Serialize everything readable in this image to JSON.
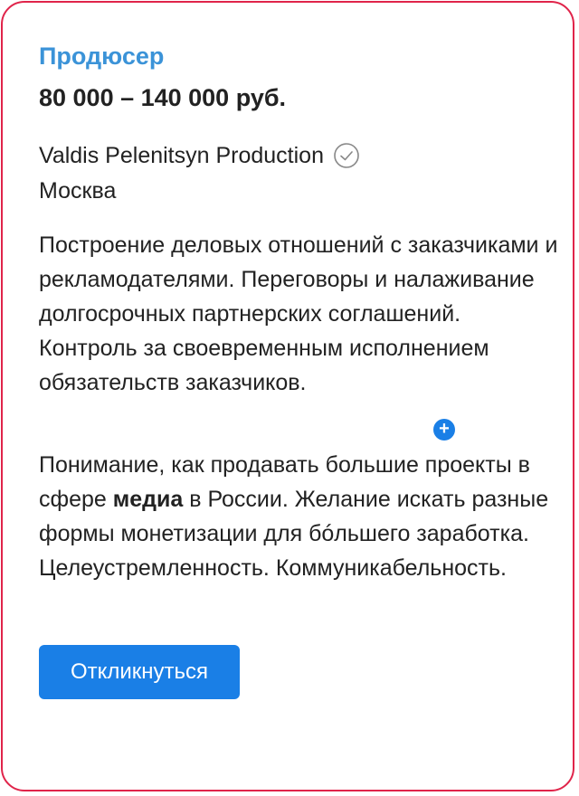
{
  "vacancy": {
    "title": "Продюсер",
    "salary": "80 000 – 140 000 руб.",
    "company": "Valdis Pelenitsyn Production",
    "company_verified_icon": "verified-check-icon",
    "city": "Москва",
    "responsibilities": "Построение деловых отношений с заказчиками и рекламодателями. Переговоры и налаживание долгосрочных партнерских соглашений. Контроль за своевременным исполнением обязательств заказчиков.",
    "requirements": {
      "before_highlight": "Понимание, как продавать большие проекты в сфере ",
      "highlight": "медиа",
      "after_highlight": " в России. Желание искать разные формы монетизации для бóльшего заработка. Целеустремленность. Коммуникабельность."
    },
    "apply_label": "Откликнуться"
  },
  "overlay": {
    "plus_symbol": "+",
    "plus_icon": "plus-circle-icon"
  },
  "colors": {
    "accent_blue": "#1a7fe6",
    "title_blue": "#3b93d8",
    "border_red": "#e0244a",
    "text": "#222222"
  }
}
